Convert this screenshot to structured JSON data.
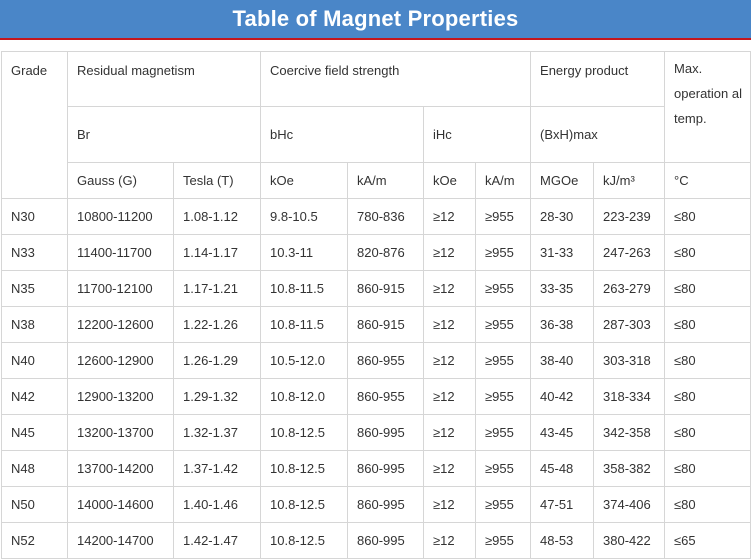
{
  "title": "Table of Magnet Properties",
  "header": {
    "grade": "Grade",
    "residual": "Residual magnetism",
    "coercive": "Coercive field strength",
    "energy": "Energy product",
    "maxop": "Max. operation al temp.",
    "br": "Br",
    "bhc": "bHc",
    "ihc": "iHc",
    "bhmax": "(BxH)max",
    "units": [
      "Gauss (G)",
      "Tesla (T)",
      "kOe",
      "kA/m",
      "kOe",
      "kA/m",
      "MGOe",
      "kJ/m³",
      "°C"
    ]
  },
  "rows": [
    [
      "N30",
      "10800-11200",
      "1.08-1.12",
      "9.8-10.5",
      "780-836",
      "≥12",
      "≥955",
      "28-30",
      "223-239",
      "≤80"
    ],
    [
      "N33",
      "11400-11700",
      "1.14-1.17",
      "10.3-11",
      "820-876",
      "≥12",
      "≥955",
      "31-33",
      "247-263",
      "≤80"
    ],
    [
      "N35",
      "11700-12100",
      "1.17-1.21",
      "10.8-11.5",
      "860-915",
      "≥12",
      "≥955",
      "33-35",
      "263-279",
      "≤80"
    ],
    [
      "N38",
      "12200-12600",
      "1.22-1.26",
      "10.8-11.5",
      "860-915",
      "≥12",
      "≥955",
      "36-38",
      "287-303",
      "≤80"
    ],
    [
      "N40",
      "12600-12900",
      "1.26-1.29",
      "10.5-12.0",
      "860-955",
      "≥12",
      "≥955",
      "38-40",
      "303-318",
      "≤80"
    ],
    [
      "N42",
      "12900-13200",
      "1.29-1.32",
      "10.8-12.0",
      "860-955",
      "≥12",
      "≥955",
      "40-42",
      "318-334",
      "≤80"
    ],
    [
      "N45",
      "13200-13700",
      "1.32-1.37",
      "10.8-12.5",
      "860-995",
      "≥12",
      "≥955",
      "43-45",
      "342-358",
      "≤80"
    ],
    [
      "N48",
      "13700-14200",
      "1.37-1.42",
      "10.8-12.5",
      "860-995",
      "≥12",
      "≥955",
      "45-48",
      "358-382",
      "≤80"
    ],
    [
      "N50",
      "14000-14600",
      "1.40-1.46",
      "10.8-12.5",
      "860-995",
      "≥12",
      "≥955",
      "47-51",
      "374-406",
      "≤80"
    ],
    [
      "N52",
      "14200-14700",
      "1.42-1.47",
      "10.8-12.5",
      "860-995",
      "≥12",
      "≥955",
      "48-53",
      "380-422",
      "≤65"
    ]
  ]
}
